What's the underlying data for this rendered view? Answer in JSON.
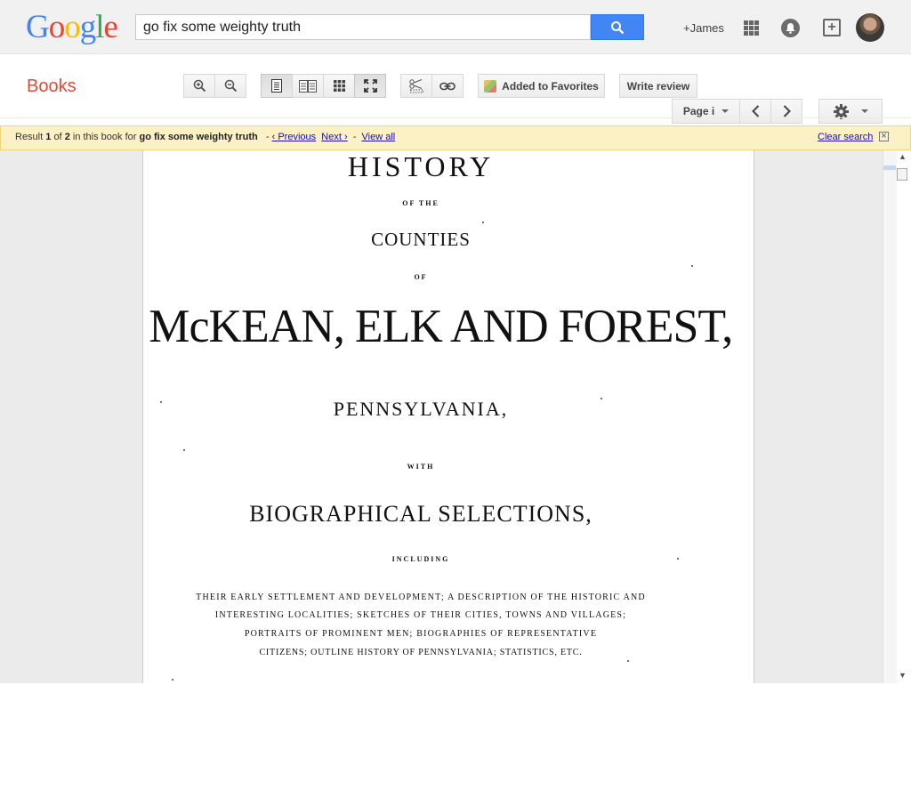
{
  "header": {
    "logo": [
      "G",
      "o",
      "o",
      "g",
      "l",
      "e"
    ],
    "logo_colors": [
      "#4285f4",
      "#ea4335",
      "#fbbc05",
      "#4285f4",
      "#34a853",
      "#ea4335"
    ],
    "search_value": "go fix some weighty truth",
    "user_link": "+James"
  },
  "toolbar": {
    "section_title": "Books",
    "favorites_label": "Added to Favorites",
    "review_label": "Write review",
    "page_label": "Page i"
  },
  "results": {
    "prefix": "Result",
    "current": "1",
    "of_text": "of",
    "total": "2",
    "in_book_text": "in this book for",
    "query": "go fix some weighty truth",
    "previous": "‹ Previous",
    "next": "Next ›",
    "view_all": "View all",
    "clear_search": "Clear search"
  },
  "book_page": {
    "line1": "HISTORY",
    "line2": "OF THE",
    "line3": "COUNTIES",
    "line4": "OF",
    "line5": "McKEAN, ELK AND FOREST,",
    "line6": "PENNSYLVANIA,",
    "line7": "WITH",
    "line8": "BIOGRAPHICAL SELECTIONS,",
    "line9": "INCLUDING",
    "desc1": "THEIR EARLY SETTLEMENT AND DEVELOPMENT; A DESCRIPTION OF THE HISTORIC AND",
    "desc2": "INTERESTING LOCALITIES; SKETCHES OF THEIR CITIES, TOWNS AND VILLAGES;",
    "desc3": "PORTRAITS OF PROMINENT MEN; BIOGRAPHIES OF REPRESENTATIVE",
    "desc4": "CITIZENS; OUTLINE HISTORY OF PENNSYLVANIA; STATISTICS, ETC."
  },
  "colors": {
    "accent": "#4285f4",
    "books_red": "#dd4b39",
    "result_bar": "#fcf1c4",
    "link": "#1a0dab"
  },
  "icons": [
    "search-icon",
    "apps-icon",
    "notification-icon",
    "share-plus-icon",
    "zoom-in-icon",
    "zoom-out-icon",
    "single-page-icon",
    "two-page-icon",
    "thumbnail-icon",
    "fullscreen-icon",
    "clip-icon",
    "link-icon",
    "chevron-left-icon",
    "chevron-right-icon",
    "gear-icon",
    "close-icon"
  ]
}
